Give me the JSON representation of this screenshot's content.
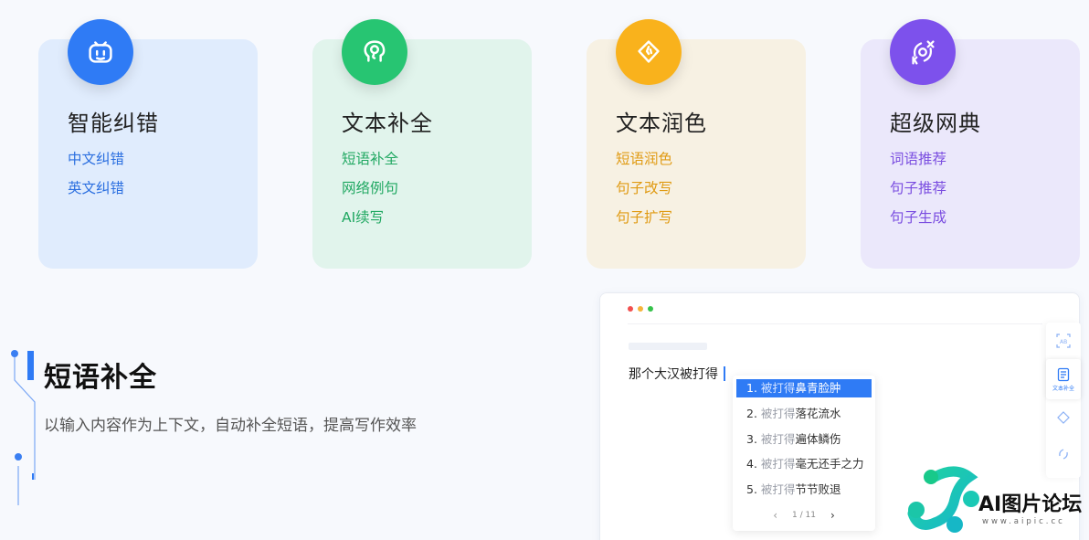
{
  "cards": [
    {
      "title": "智能纠错",
      "links": [
        "中文纠错",
        "英文纠错"
      ]
    },
    {
      "title": "文本补全",
      "links": [
        "短语补全",
        "网络例句",
        "AI续写"
      ]
    },
    {
      "title": "文本润色",
      "links": [
        "短语润色",
        "句子改写",
        "句子扩写"
      ]
    },
    {
      "title": "超级网典",
      "links": [
        "词语推荐",
        "句子推荐",
        "句子生成"
      ]
    }
  ],
  "feature": {
    "title": "短语补全",
    "desc": "以输入内容作为上下文，自动补全短语，提高写作效率"
  },
  "editor": {
    "typed": "那个大汉被打得",
    "suggestions": [
      {
        "num": "1.",
        "prefix": "被打得",
        "phrase": "鼻青脸肿"
      },
      {
        "num": "2.",
        "prefix": "被打得",
        "phrase": "落花流水"
      },
      {
        "num": "3.",
        "prefix": "被打得",
        "phrase": "遍体鳞伤"
      },
      {
        "num": "4.",
        "prefix": "被打得",
        "phrase": "毫无还手之力"
      },
      {
        "num": "5.",
        "prefix": "被打得",
        "phrase": "节节败退"
      }
    ],
    "pager": "1 / 11",
    "tool_label": "文本补全"
  },
  "watermark": {
    "text": "AI图片论坛",
    "url": "www.aipic.cc"
  },
  "colors": {
    "blue": "#2f7bf5",
    "green": "#27c572",
    "yellow": "#f9b21c",
    "purple": "#7d51ec"
  }
}
